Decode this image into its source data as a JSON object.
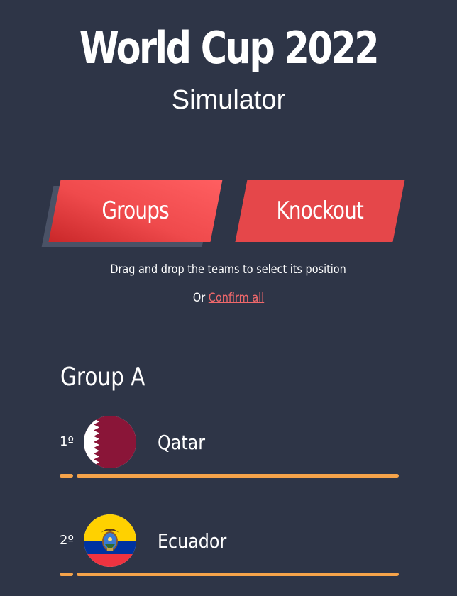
{
  "header": {
    "title": "World Cup 2022",
    "subtitle": "Simulator"
  },
  "tabs": [
    {
      "label": "Groups",
      "active": true
    },
    {
      "label": "Knockout",
      "active": false
    }
  ],
  "instructions": {
    "text": "Drag and drop the teams to select its position",
    "confirm_prefix": "Or",
    "confirm_link": "Confirm all"
  },
  "group": {
    "name": "Group A",
    "teams": [
      {
        "position": "1º",
        "name": "Qatar",
        "flag_icon": "qatar-flag-icon"
      },
      {
        "position": "2º",
        "name": "Ecuador",
        "flag_icon": "ecuador-flag-icon"
      }
    ]
  },
  "colors": {
    "background": "#2e3547",
    "accent": "#e5474a",
    "link": "#f0686b",
    "divider": "#f5a34a"
  }
}
